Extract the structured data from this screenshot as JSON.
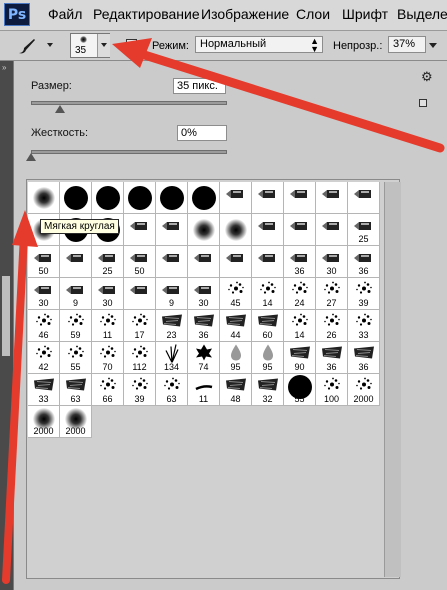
{
  "app": {
    "logo": "Ps"
  },
  "menubar": {
    "items": [
      "Файл",
      "Редактирование",
      "Изображение",
      "Слои",
      "Шрифт",
      "Выделен"
    ]
  },
  "options": {
    "brush_size": "35",
    "mode_label": "Режим:",
    "mode_value": "Нормальный",
    "opacity_label": "Непрозр.:",
    "opacity_value": "37%"
  },
  "brush_panel": {
    "size_label": "Размер:",
    "size_value": "35 пикс.",
    "size_fraction": 0.15,
    "hardness_label": "Жесткость:",
    "hardness_value": "0%",
    "hardness_fraction": 0.0,
    "tooltip": "Мягкая круглая"
  },
  "presets": [
    {
      "k": "soft",
      "n": ""
    },
    {
      "k": "hard",
      "n": ""
    },
    {
      "k": "hard",
      "n": ""
    },
    {
      "k": "hard",
      "n": ""
    },
    {
      "k": "hard",
      "n": ""
    },
    {
      "k": "hard",
      "n": ""
    },
    {
      "k": "tool",
      "n": ""
    },
    {
      "k": "tool",
      "n": ""
    },
    {
      "k": "tool",
      "n": ""
    },
    {
      "k": "tool",
      "n": ""
    },
    {
      "k": "tool",
      "n": ""
    },
    {
      "k": "soft",
      "n": ""
    },
    {
      "k": "hard",
      "n": ""
    },
    {
      "k": "hard",
      "n": ""
    },
    {
      "k": "tool",
      "n": ""
    },
    {
      "k": "tool",
      "n": ""
    },
    {
      "k": "soft",
      "n": ""
    },
    {
      "k": "soft",
      "n": ""
    },
    {
      "k": "tool",
      "n": ""
    },
    {
      "k": "tool",
      "n": ""
    },
    {
      "k": "tool",
      "n": ""
    },
    {
      "k": "tool",
      "n": "25"
    },
    {
      "k": "tool",
      "n": "50"
    },
    {
      "k": "tool",
      "n": ""
    },
    {
      "k": "tool",
      "n": "25"
    },
    {
      "k": "tool",
      "n": "50"
    },
    {
      "k": "tool",
      "n": ""
    },
    {
      "k": "tool",
      "n": ""
    },
    {
      "k": "tool",
      "n": ""
    },
    {
      "k": "tool",
      "n": ""
    },
    {
      "k": "tool",
      "n": "36"
    },
    {
      "k": "tool",
      "n": "30"
    },
    {
      "k": "tool",
      "n": "36"
    },
    {
      "k": "tool",
      "n": "30"
    },
    {
      "k": "tool",
      "n": "9"
    },
    {
      "k": "tool",
      "n": "30"
    },
    {
      "k": "tool",
      "n": ""
    },
    {
      "k": "tool",
      "n": "9"
    },
    {
      "k": "tool",
      "n": "30"
    },
    {
      "k": "spray",
      "n": "45"
    },
    {
      "k": "spray",
      "n": "14"
    },
    {
      "k": "spray",
      "n": "24"
    },
    {
      "k": "spray",
      "n": "27"
    },
    {
      "k": "spray",
      "n": "39"
    },
    {
      "k": "spray",
      "n": "46"
    },
    {
      "k": "spray",
      "n": "59"
    },
    {
      "k": "spray",
      "n": "11"
    },
    {
      "k": "spray",
      "n": "17"
    },
    {
      "k": "tex",
      "n": "23"
    },
    {
      "k": "tex",
      "n": "36"
    },
    {
      "k": "tex",
      "n": "44"
    },
    {
      "k": "tex",
      "n": "60"
    },
    {
      "k": "spray",
      "n": "14"
    },
    {
      "k": "spray",
      "n": "26"
    },
    {
      "k": "spray",
      "n": "33"
    },
    {
      "k": "spray",
      "n": "42"
    },
    {
      "k": "spray",
      "n": "55"
    },
    {
      "k": "spray",
      "n": "70"
    },
    {
      "k": "spray",
      "n": "112"
    },
    {
      "k": "grass",
      "n": "134"
    },
    {
      "k": "leaf",
      "n": "74"
    },
    {
      "k": "drop",
      "n": "95"
    },
    {
      "k": "drop",
      "n": "95"
    },
    {
      "k": "tex",
      "n": "90"
    },
    {
      "k": "tex",
      "n": "36"
    },
    {
      "k": "tex",
      "n": "36"
    },
    {
      "k": "tex",
      "n": "33"
    },
    {
      "k": "tex",
      "n": "63"
    },
    {
      "k": "spray",
      "n": "66"
    },
    {
      "k": "spray",
      "n": "39"
    },
    {
      "k": "spray",
      "n": "63"
    },
    {
      "k": "dash",
      "n": "11"
    },
    {
      "k": "tex",
      "n": "48"
    },
    {
      "k": "tex",
      "n": "32"
    },
    {
      "k": "hard",
      "n": "55"
    },
    {
      "k": "spray",
      "n": "100"
    },
    {
      "k": "spray",
      "n": "2000"
    },
    {
      "k": "soft",
      "n": "2000"
    },
    {
      "k": "soft",
      "n": "2000"
    }
  ]
}
